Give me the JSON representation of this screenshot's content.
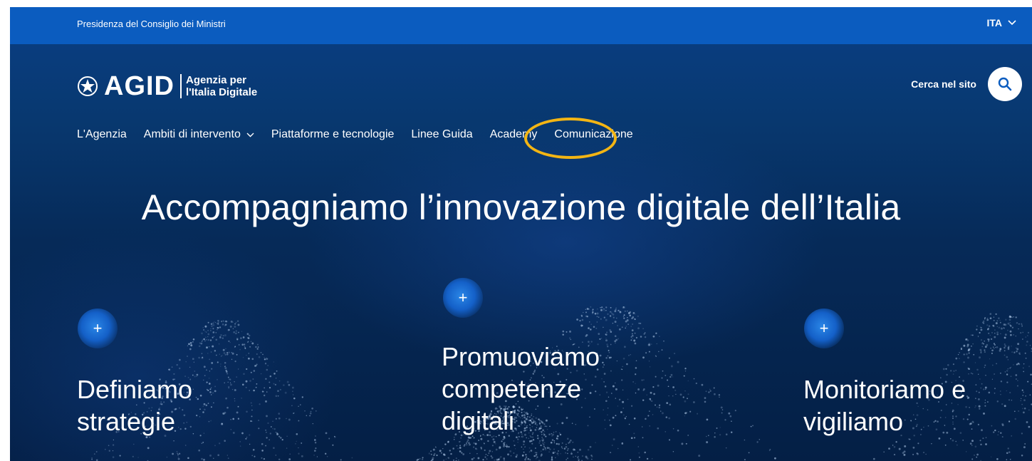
{
  "topbar": {
    "gov_name": "Presidenza del Consiglio dei Ministri",
    "language": "ITA",
    "lang_icon": "chevron-down-icon"
  },
  "brand": {
    "name": "AGID",
    "subtitle_line1": "Agenzia per",
    "subtitle_line2": "l'Italia Digitale",
    "emblem_icon": "emblem-icon"
  },
  "search": {
    "label": "Cerca nel sito",
    "icon": "search-icon"
  },
  "nav": {
    "items": [
      {
        "label": "L'Agenzia",
        "has_dropdown": false
      },
      {
        "label": "Ambiti di intervento",
        "has_dropdown": true
      },
      {
        "label": "Piattaforme e tecnologie",
        "has_dropdown": false
      },
      {
        "label": "Linee Guida",
        "has_dropdown": false
      },
      {
        "label": "Academy",
        "has_dropdown": false,
        "highlighted": true
      },
      {
        "label": "Comunicazione",
        "has_dropdown": false
      }
    ]
  },
  "hero": {
    "title": "Accompagniamo l’innovazione digitale dell’Italia"
  },
  "features": [
    {
      "plus": "+",
      "line1": "Definiamo",
      "line2": "strategie",
      "line3": ""
    },
    {
      "plus": "+",
      "line1": "Promuoviamo",
      "line2": "competenze",
      "line3": "digitali"
    },
    {
      "plus": "+",
      "line1": "Monitoriamo e",
      "line2": "vigiliamo",
      "line3": ""
    }
  ],
  "colors": {
    "topbar": "#0b5cbf",
    "background": "#062a58",
    "highlight": "#f3b514",
    "search_button": "#ffffff"
  }
}
